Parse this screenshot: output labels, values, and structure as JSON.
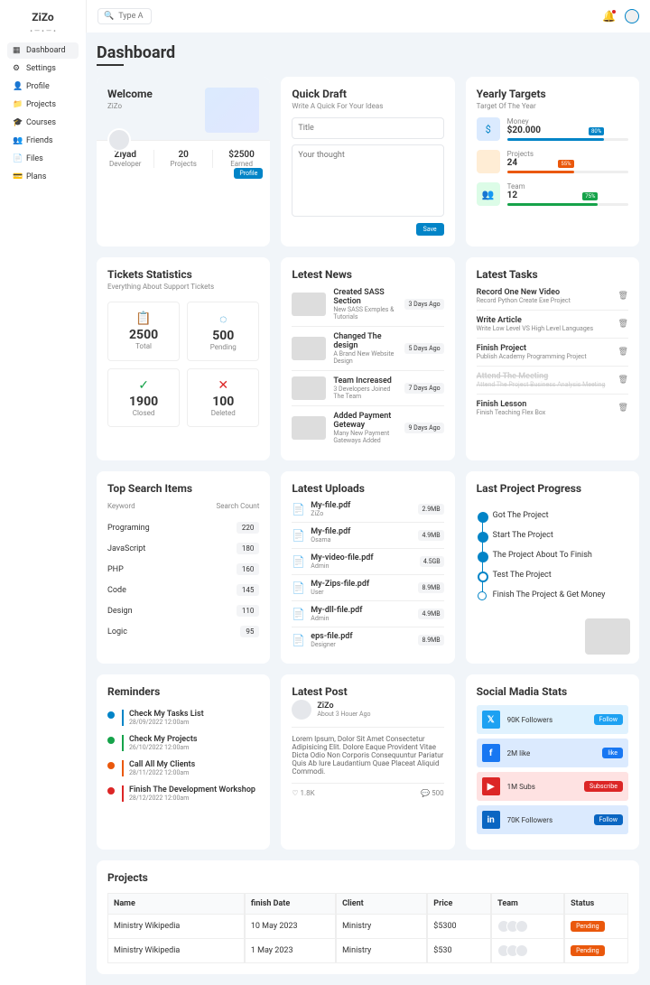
{
  "logo": "ZiZo",
  "search_placeholder": "Type A Keywo",
  "nav": [
    {
      "icon": "▦",
      "label": "Dashboard",
      "active": true
    },
    {
      "icon": "⚙",
      "label": "Settings"
    },
    {
      "icon": "👤",
      "label": "Profile"
    },
    {
      "icon": "📁",
      "label": "Projects"
    },
    {
      "icon": "🎓",
      "label": "Courses"
    },
    {
      "icon": "👥",
      "label": "Friends"
    },
    {
      "icon": "📄",
      "label": "Files"
    },
    {
      "icon": "💳",
      "label": "Plans"
    }
  ],
  "page_title": "Dashboard",
  "welcome": {
    "title": "Welcome",
    "name": "ZiZo",
    "stats": [
      {
        "v": "Ziyad",
        "l": "Developer"
      },
      {
        "v": "20",
        "l": "Projects"
      },
      {
        "v": "$2500",
        "l": "Earned"
      }
    ],
    "profile_btn": "Profile"
  },
  "draft": {
    "title": "Quick Draft",
    "sub": "Write A Quick For Your Ideas",
    "title_ph": "Title",
    "body_ph": "Your thought",
    "save": "Save"
  },
  "targets": {
    "title": "Yearly Targets",
    "sub": "Target Of The Year",
    "items": [
      {
        "icon": "$",
        "cls": "blue",
        "label": "Money",
        "value": "$20.000",
        "pct": 80
      },
      {
        "icon": "</>",
        "cls": "orange",
        "label": "Projects",
        "value": "24",
        "pct": 55
      },
      {
        "icon": "👥",
        "cls": "green",
        "label": "Team",
        "value": "12",
        "pct": 75
      }
    ]
  },
  "tickets": {
    "title": "Tickets Statistics",
    "sub": "Everything About Support Tickets",
    "boxes": [
      {
        "icon": "📋",
        "color": "#ea580c",
        "v": "2500",
        "l": "Total"
      },
      {
        "icon": "◌",
        "color": "#0284c7",
        "v": "500",
        "l": "Pending"
      },
      {
        "icon": "✓",
        "color": "#16a34a",
        "v": "1900",
        "l": "Closed"
      },
      {
        "icon": "✕",
        "color": "#dc2626",
        "v": "100",
        "l": "Deleted"
      }
    ]
  },
  "news": {
    "title": "Letest News",
    "items": [
      {
        "t": "Created SASS Section",
        "s": "New SASS Exmples & Tutorials",
        "time": "3 Days Ago"
      },
      {
        "t": "Changed The design",
        "s": "A Brand New Website Design",
        "time": "5 Days Ago"
      },
      {
        "t": "Team Increased",
        "s": "3 Developers Joined The Team",
        "time": "7 Days Ago"
      },
      {
        "t": "Added Payment Geteway",
        "s": "Many New Payment Gateways Added",
        "time": "9 Days Ago"
      }
    ]
  },
  "tasks": {
    "title": "Latest Tasks",
    "items": [
      {
        "t": "Record One New Video",
        "s": "Record Python Create Exe Project",
        "done": false
      },
      {
        "t": "Write Article",
        "s": "Write Low Level VS High Level Languages",
        "done": false
      },
      {
        "t": "Finish Project",
        "s": "Publish Academy Programming Project",
        "done": false
      },
      {
        "t": "Attend The Meeting",
        "s": "Attend The Project Business Analysis Meeting",
        "done": true
      },
      {
        "t": "Finish Lesson",
        "s": "Finish Teaching Flex Box",
        "done": false
      }
    ]
  },
  "searchItems": {
    "title": "Top Search Items",
    "kh": "Keyword",
    "ch": "Search Count",
    "rows": [
      {
        "k": "Programing",
        "c": "220"
      },
      {
        "k": "JavaScript",
        "c": "180"
      },
      {
        "k": "PHP",
        "c": "160"
      },
      {
        "k": "Code",
        "c": "145"
      },
      {
        "k": "Design",
        "c": "110"
      },
      {
        "k": "Logic",
        "c": "95"
      }
    ]
  },
  "uploads": {
    "title": "Latest Uploads",
    "items": [
      {
        "n": "My-file.pdf",
        "o": "ZiZo",
        "s": "2.9MB"
      },
      {
        "n": "My-file.pdf",
        "o": "Osama",
        "s": "4.9MB"
      },
      {
        "n": "My-video-file.pdf",
        "o": "Admin",
        "s": "4.5GB"
      },
      {
        "n": "My-Zips-file.pdf",
        "o": "User",
        "s": "8.9MB"
      },
      {
        "n": "My-dll-file.pdf",
        "o": "Admin",
        "s": "4.9MB"
      },
      {
        "n": "eps-file.pdf",
        "o": "Designer",
        "s": "8.9MB"
      }
    ]
  },
  "projProgress": {
    "title": "Last Project Progress",
    "steps": [
      {
        "t": "Got The Project",
        "done": true
      },
      {
        "t": "Start The Project",
        "done": true
      },
      {
        "t": "The Project About To Finish",
        "done": true
      },
      {
        "t": "Test The Project",
        "done": false,
        "current": true
      },
      {
        "t": "Finish The Project & Get Money",
        "done": false
      }
    ]
  },
  "reminders": {
    "title": "Reminders",
    "items": [
      {
        "t": "Check My Tasks List",
        "d": "28/09/2022 12:00am",
        "c": "#0284c7"
      },
      {
        "t": "Check My Projects",
        "d": "26/10/2022 12:00am",
        "c": "#16a34a"
      },
      {
        "t": "Call All My Clients",
        "d": "28/11/2022 12:00am",
        "c": "#ea580c"
      },
      {
        "t": "Finish The Development Workshop",
        "d": "28/12/2022 12:00am",
        "c": "#dc2626"
      }
    ]
  },
  "post": {
    "title": "Latest Post",
    "name": "ZiZo",
    "time": "About 3 Houer Ago",
    "body": "Lorem Ipsum, Dolor Sit Amet Consectetur Adipisicing Elit. Dolore Eaque Provident Vitae Dicta Odio Non Corporis Consequuntur Pariatur Quis Ab Iure Laudantium Quae Placeat Aliquid Commodi.",
    "likes": "1.8K",
    "comments": "500"
  },
  "social": {
    "title": "Social Madia Stats",
    "items": [
      {
        "platform": "tw",
        "icon": "𝕏",
        "text": "90K Followers",
        "btn": "Follow"
      },
      {
        "platform": "fb",
        "icon": "f",
        "text": "2M like",
        "btn": "like"
      },
      {
        "platform": "yt",
        "icon": "▶",
        "text": "1M Subs",
        "btn": "Subscribe"
      },
      {
        "platform": "li",
        "icon": "in",
        "text": "70K Followers",
        "btn": "Follow"
      }
    ]
  },
  "projects": {
    "title": "Projects",
    "headers": [
      "Name",
      "finish Date",
      "Client",
      "Price",
      "Team",
      "Status"
    ],
    "rows": [
      {
        "name": "Ministry Wikipedia",
        "date": "10 May 2023",
        "client": "Ministry",
        "price": "$5300",
        "status": "Pending"
      },
      {
        "name": "Ministry Wikipedia",
        "date": "1 May 2023",
        "client": "Ministry",
        "price": "$530",
        "status": "Pending"
      }
    ]
  }
}
